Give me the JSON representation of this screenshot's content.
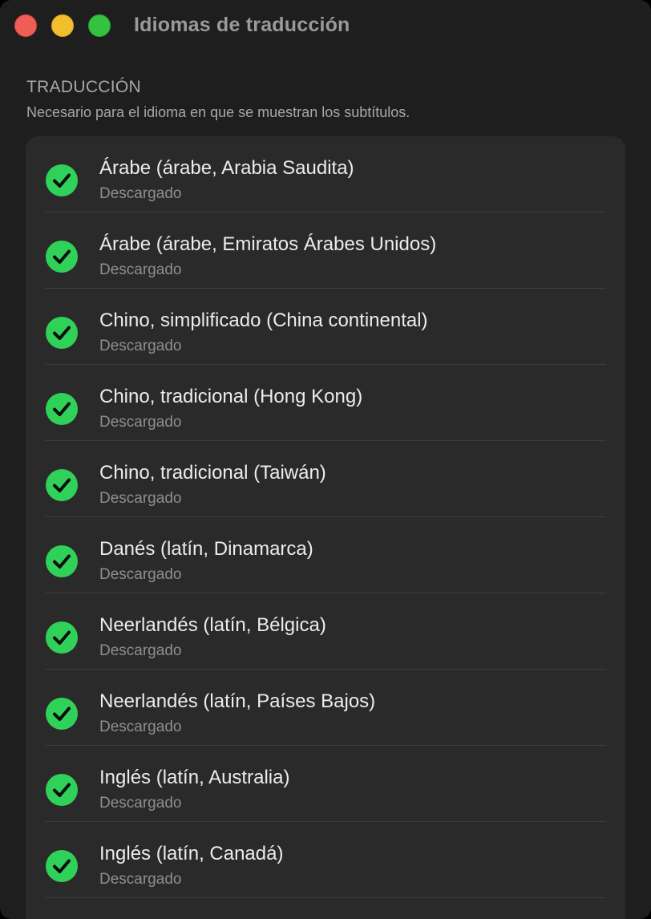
{
  "window": {
    "title": "Idiomas de traducción"
  },
  "section": {
    "header": "TRADUCCIÓN",
    "subtitle": "Necesario para el idioma en que se muestran los subtítulos."
  },
  "languages": [
    {
      "name": "Árabe (árabe, Arabia Saudita)",
      "status": "Descargado"
    },
    {
      "name": "Árabe (árabe, Emiratos Árabes Unidos)",
      "status": "Descargado"
    },
    {
      "name": "Chino, simplificado (China continental)",
      "status": "Descargado"
    },
    {
      "name": "Chino, tradicional (Hong Kong)",
      "status": "Descargado"
    },
    {
      "name": "Chino, tradicional (Taiwán)",
      "status": "Descargado"
    },
    {
      "name": "Danés (latín, Dinamarca)",
      "status": "Descargado"
    },
    {
      "name": "Neerlandés (latín, Bélgica)",
      "status": "Descargado"
    },
    {
      "name": "Neerlandés (latín, Países Bajos)",
      "status": "Descargado"
    },
    {
      "name": "Inglés (latín, Australia)",
      "status": "Descargado"
    },
    {
      "name": "Inglés (latín, Canadá)",
      "status": "Descargado"
    }
  ],
  "colors": {
    "check": "#30d158",
    "close": "#ee5d56",
    "minimize": "#f3be2d",
    "zoom": "#35c23f"
  }
}
